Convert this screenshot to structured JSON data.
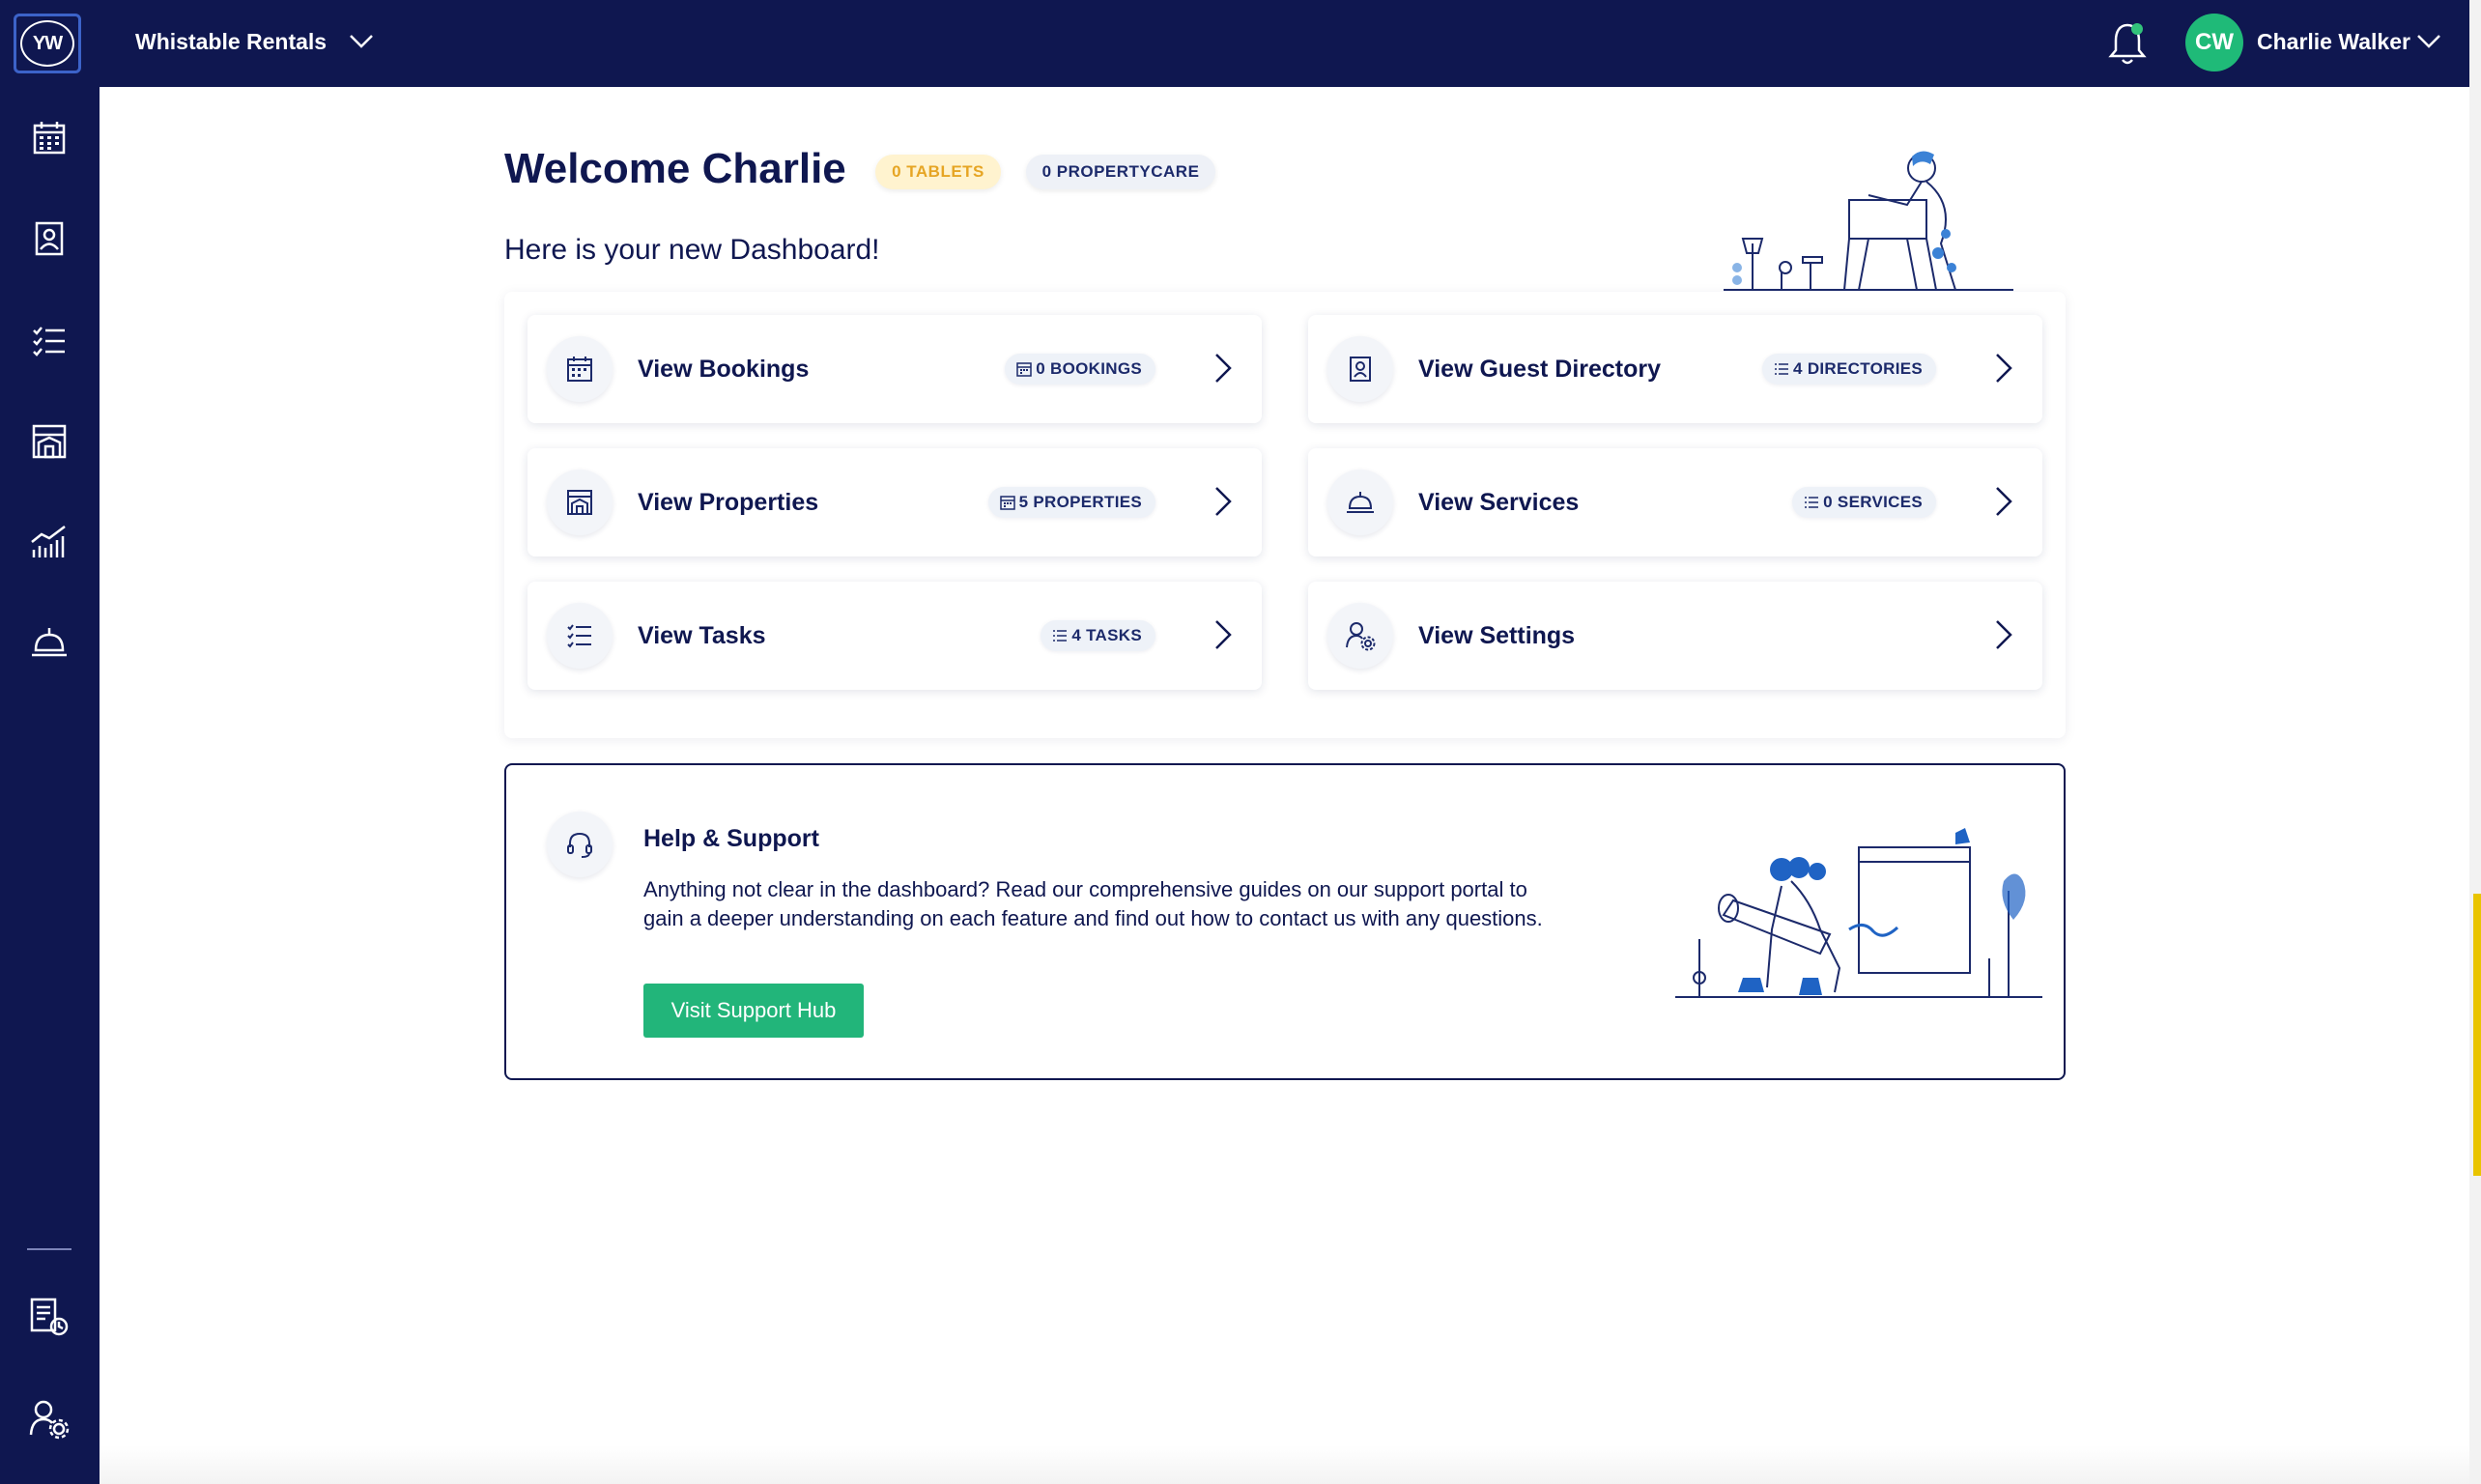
{
  "topbar": {
    "logo_text": "YW",
    "account_name": "Whistable Rentals",
    "user": {
      "initials": "CW",
      "name": "Charlie Walker"
    },
    "colors": {
      "background": "#0f1750",
      "avatar": "#1fba78",
      "notification_dot": "#32c27a"
    }
  },
  "sidebar": {
    "items": [
      {
        "icon": "calendar-icon"
      },
      {
        "icon": "contact-book-icon"
      },
      {
        "icon": "task-list-icon"
      },
      {
        "icon": "property-icon"
      },
      {
        "icon": "analytics-icon"
      },
      {
        "icon": "service-bell-icon"
      },
      {
        "icon": "reports-icon"
      },
      {
        "icon": "user-settings-icon"
      }
    ]
  },
  "header": {
    "title": "Welcome Charlie",
    "pills": {
      "tablets": "0 TABLETS",
      "propertycare": "0 PROPERTYCARE"
    },
    "subtitle": "Here is your new Dashboard!"
  },
  "cards": [
    {
      "title": "View Bookings",
      "badge": "0 BOOKINGS",
      "icon": "calendar-icon",
      "badge_icon": "calendar-icon"
    },
    {
      "title": "View Guest Directory",
      "badge": "4 DIRECTORIES",
      "icon": "contact-book-icon",
      "badge_icon": "list-icon"
    },
    {
      "title": "View Properties",
      "badge": "5 PROPERTIES",
      "icon": "property-icon",
      "badge_icon": "calendar-icon"
    },
    {
      "title": "View Services",
      "badge": "0 SERVICES",
      "icon": "service-bell-icon",
      "badge_icon": "list-icon"
    },
    {
      "title": "View Tasks",
      "badge": "4 TASKS",
      "icon": "task-list-icon",
      "badge_icon": "list-icon"
    },
    {
      "title": "View Settings",
      "badge": "",
      "icon": "user-settings-icon",
      "badge_icon": ""
    }
  ],
  "help": {
    "title": "Help & Support",
    "body": "Anything not clear in the dashboard? Read our comprehensive guides on our support portal to gain a deeper understanding on each feature and find out how to contact us with any questions.",
    "button": "Visit Support Hub",
    "button_color": "#22b57a"
  }
}
